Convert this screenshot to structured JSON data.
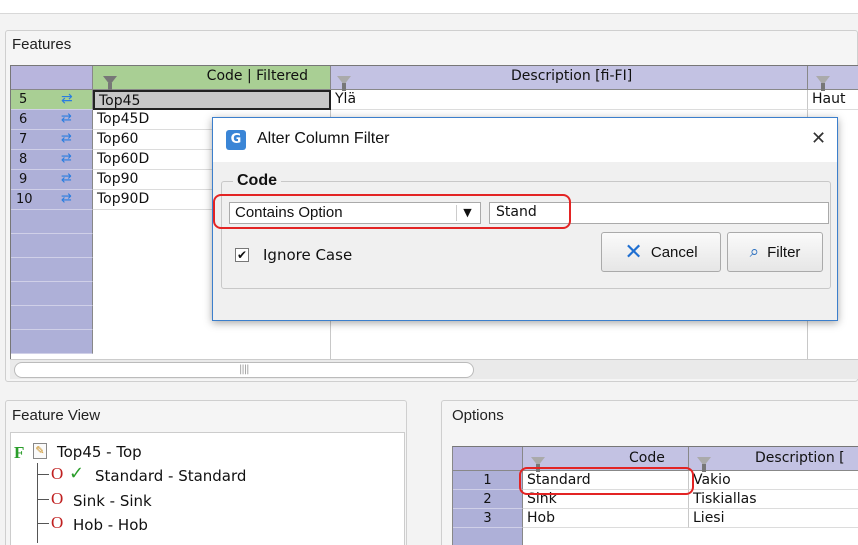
{
  "features_panel": {
    "title": "Features",
    "columns": [
      "Code | Filtered",
      "Description [fi-FI]"
    ],
    "rows": [
      {
        "num": "5",
        "code": "Top45",
        "desc": "Ylä",
        "extra": "Haut"
      },
      {
        "num": "6",
        "code": "Top45D",
        "desc": "",
        "extra": ""
      },
      {
        "num": "7",
        "code": "Top60",
        "desc": "",
        "extra": ""
      },
      {
        "num": "8",
        "code": "Top60D",
        "desc": "",
        "extra": ""
      },
      {
        "num": "9",
        "code": "Top90",
        "desc": "",
        "extra": ""
      },
      {
        "num": "10",
        "code": "Top90D",
        "desc": "",
        "extra": ""
      }
    ]
  },
  "dialog": {
    "title": "Alter Column Filter",
    "close_glyph": "✕",
    "group_label": "Code",
    "filter_type": "Contains Option",
    "filter_value": "Stand",
    "ignore_case_label": "Ignore Case",
    "ignore_case_checked": true,
    "cancel_label": "Cancel",
    "filter_label": "Filter"
  },
  "feature_view": {
    "title": "Feature View",
    "root_marker": "F",
    "root_label": "Top45 - Top",
    "option_marker": "O",
    "items": [
      {
        "label": "Standard - Standard",
        "checked": true
      },
      {
        "label": "Sink - Sink",
        "checked": false
      },
      {
        "label": "Hob - Hob",
        "checked": false
      }
    ]
  },
  "options_panel": {
    "title": "Options",
    "columns": [
      "Code",
      "Description ["
    ],
    "rows": [
      {
        "num": "1",
        "code": "Standard",
        "desc": "Vakio"
      },
      {
        "num": "2",
        "code": "Sink",
        "desc": "Tiskiallas"
      },
      {
        "num": "3",
        "code": "Hob",
        "desc": "Liesi"
      }
    ]
  },
  "colors": {
    "header_lavender": "#b8b5dd",
    "filtered_header_green": "#a9cf94",
    "highlight_red": "#e32424",
    "dialog_border": "#3c7fcc"
  }
}
